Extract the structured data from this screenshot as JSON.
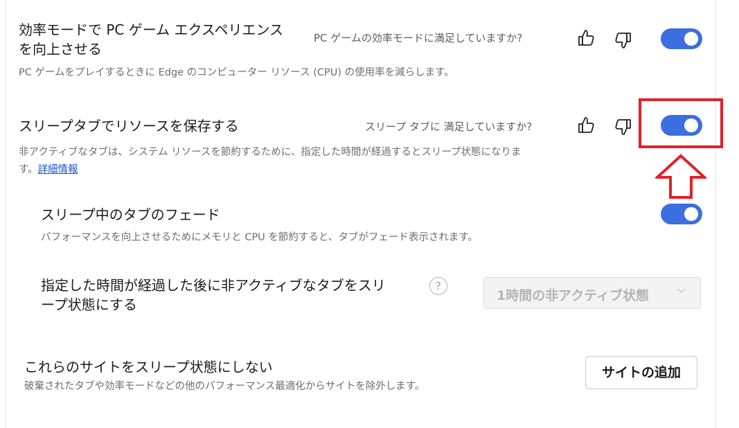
{
  "efficiency": {
    "title_line1": "効率モードで PC ゲーム エクスペリエンス",
    "title_line2": "を向上させる",
    "feedback": "PC ゲームの効率モードに満足していますか?",
    "description": "PC ゲームをプレイするときに Edge のコンピューター リソース (CPU) の使用率を減らします。",
    "toggle_on": true
  },
  "sleeping_tabs": {
    "title": "スリープタブでリソースを保存する",
    "feedback": "スリープ タブに 満足していますか?",
    "description_line1": "非アクティブなタブは、システム リソースを節約するために、指定した時間が経過するとスリープ状態になりま",
    "description_line2": "す。",
    "learn_more": "詳細情報",
    "toggle_on": true
  },
  "fade": {
    "title": "スリープ中のタブのフェード",
    "description": "パフォーマンスを向上させるためにメモリと CPU を節約すると、タブがフェード表示されます。",
    "toggle_on": true
  },
  "inactive_time": {
    "title_line1": "指定した時間が経過した後に非アクティブなタブをスリ",
    "title_line2": "ープ状態にする",
    "help": "?",
    "select_value": "1時間の非アクティブ状態",
    "chevron": "﹀"
  },
  "never_sleep": {
    "title": "これらのサイトをスリープ状態にしない",
    "description": "破棄されたタブや効率モードなどの他のパフォーマンス最適化からサイトを除外します。",
    "add_button": "サイトの追加"
  },
  "icons": {
    "thumbs_up": "thumbs-up-icon",
    "thumbs_down": "thumbs-down-icon",
    "help": "help-circle-icon",
    "arrow": "up-arrow-annotation"
  },
  "colors": {
    "toggle_on": "#3b6fe0",
    "link": "#1a56c6",
    "annotation_red": "#e2202a"
  }
}
